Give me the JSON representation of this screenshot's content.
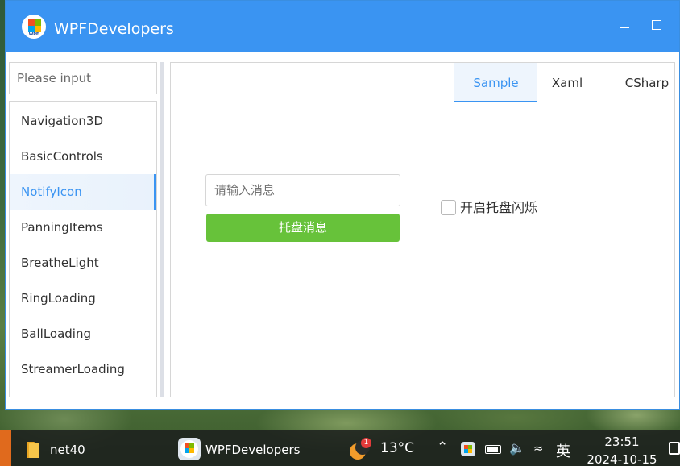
{
  "window": {
    "title": "WPFDevelopers",
    "icon_label": "WPF",
    "accent_color": "#3a94f2"
  },
  "sidebar": {
    "search_placeholder": "Please input",
    "items": [
      {
        "label": "Navigation3D"
      },
      {
        "label": "BasicControls"
      },
      {
        "label": "NotifyIcon"
      },
      {
        "label": "PanningItems"
      },
      {
        "label": "BreatheLight"
      },
      {
        "label": "RingLoading"
      },
      {
        "label": "BallLoading"
      },
      {
        "label": "StreamerLoading"
      }
    ],
    "selected": "NotifyIcon"
  },
  "tabs": [
    {
      "label": "Sample"
    },
    {
      "label": "Xaml"
    },
    {
      "label": "CSharp"
    }
  ],
  "active_tab": "Sample",
  "sample": {
    "message_placeholder": "请输入消息",
    "tray_button_label": "托盘消息",
    "tray_button_color": "#67c23a",
    "blink_checkbox_label": "开启托盘闪烁",
    "blink_checked": false
  },
  "taskbar": {
    "items": [
      {
        "label": "net40",
        "icon": "folder-icon"
      },
      {
        "label": "WPFDevelopers",
        "icon": "wpf-app-icon"
      }
    ],
    "weather": {
      "temperature": "13°C",
      "badge": "1"
    },
    "ime_label": "英",
    "time": "23:51",
    "date": "2024-10-15"
  }
}
